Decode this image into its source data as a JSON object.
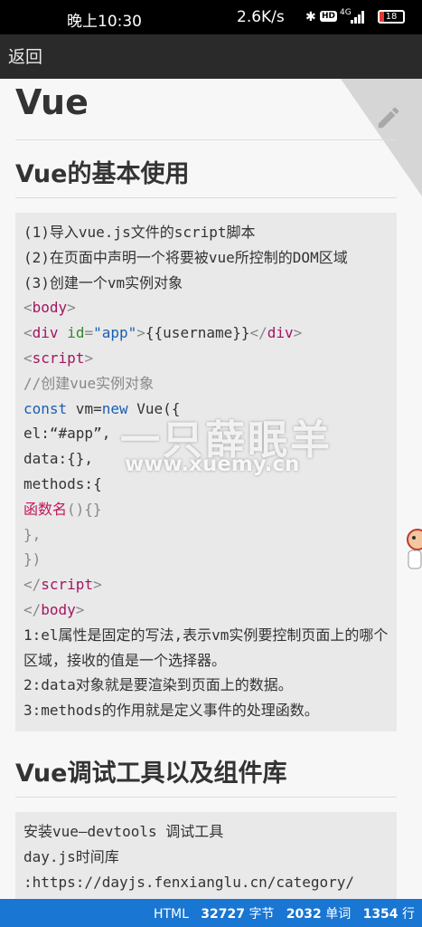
{
  "status_bar": {
    "time": "晚上10:30",
    "network_speed": "2.6K/s",
    "hd_badge": "HD",
    "signal_label": "4G",
    "battery": "18",
    "battery_level": 0.18
  },
  "app_bar": {
    "back_label": "返回"
  },
  "article": {
    "title": "Vue",
    "section1": "Vue的基本使用",
    "section2": "Vue调试工具以及组件库"
  },
  "code1": {
    "l1": "(1)导入vue.js文件的script脚本",
    "l2": "(2)在页面中声明一个将要被vue所控制的DOM区域",
    "l3": "(3)创建一个vm实例对象",
    "l4_tag": "body",
    "l5_tag": "div",
    "l5_attr": "id",
    "l5_val": "\"app\"",
    "l5_text": "{{username}}",
    "l6_tag": "script",
    "l7": "//创建vue实例对象",
    "l8_const": "const",
    "l8_mid": " vm=",
    "l8_new": "new",
    "l8_end": " Vue({",
    "l9": "el:“#app”,",
    "l10": "data:{},",
    "l11": "methods:{",
    "l12_fn": "函数名",
    "l12_rest": "(){}",
    "l13": "},",
    "l14": "})",
    "l15_tag": "script",
    "l16_tag": "body",
    "l17": "1:el属性是固定的写法,表示vm实例要控制页面上的哪个区域，接收的值是一个选择器。",
    "l18": "2:data对象就是要渲染到页面上的数据。",
    "l19": "3:methods的作用就是定义事件的处理函数。"
  },
  "code2": {
    "l1": "安装vue—devtools 调试工具",
    "l2": "day.js时间库",
    "l3": ":https://dayjs.fenxianglu.cn/category/"
  },
  "watermark": {
    "line1": "一只薛眠羊",
    "line2": "www.xuemy.cn"
  },
  "bottom_bar": {
    "lang": "HTML",
    "bytes": "32727",
    "bytes_unit": "字节",
    "words": "2032",
    "words_unit": "单词",
    "lines": "1354",
    "lines_unit": "行"
  },
  "icons": {
    "edit": "pencil-icon",
    "bluetooth": "bluetooth-icon"
  }
}
